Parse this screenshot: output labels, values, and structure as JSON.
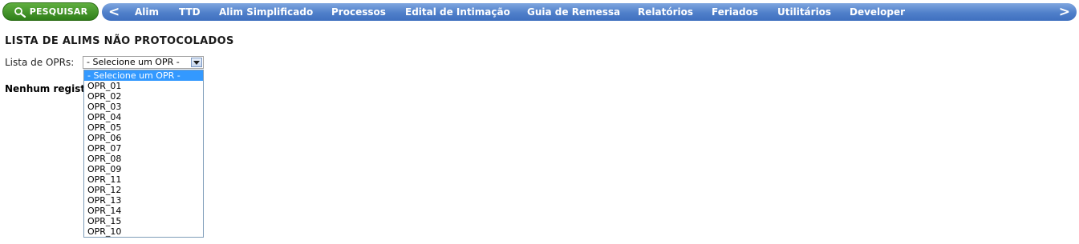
{
  "search_button": {
    "label": "PESQUISAR",
    "icon": "magnifier-icon"
  },
  "navbar": {
    "prev_label": "<",
    "next_label": ">",
    "items": [
      {
        "label": "Alim"
      },
      {
        "label": "TTD"
      },
      {
        "label": "Alim Simplificado"
      },
      {
        "label": "Processos"
      },
      {
        "label": "Edital de Intimação"
      },
      {
        "label": "Guia de Remessa"
      },
      {
        "label": "Relatórios"
      },
      {
        "label": "Feriados"
      },
      {
        "label": "Utilitários"
      },
      {
        "label": "Developer"
      }
    ]
  },
  "page": {
    "title": "LISTA DE ALIMS NÃO PROTOCOLADOS",
    "opr_label": "Lista de OPRs:",
    "selected_value": "- Selecione um OPR -",
    "no_records_text": "Nenhum regist"
  },
  "dropdown": {
    "options": [
      "- Selecione um OPR -",
      "OPR_01",
      "OPR_02",
      "OPR_03",
      "OPR_04",
      "OPR_05",
      "OPR_06",
      "OPR_07",
      "OPR_08",
      "OPR_09",
      "OPR_11",
      "OPR_12",
      "OPR_13",
      "OPR_14",
      "OPR_15",
      "OPR_10"
    ],
    "highlighted_index": 0
  },
  "colors": {
    "search_green": "#3f8f22",
    "nav_blue": "#4f7fca",
    "highlight": "#3399ff"
  }
}
